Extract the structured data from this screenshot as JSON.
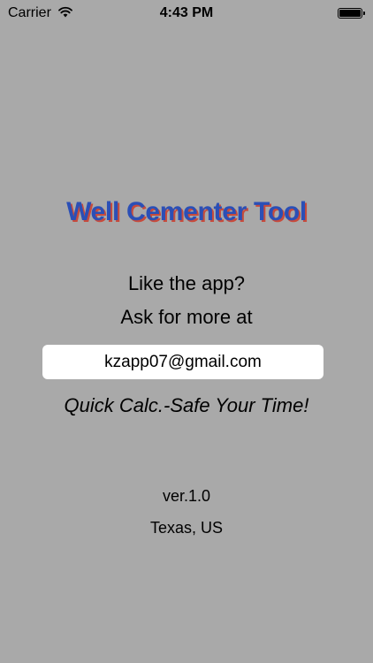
{
  "status_bar": {
    "carrier": "Carrier",
    "time": "4:43 PM",
    "wifi_icon": "wifi-icon",
    "battery_icon": "battery-icon"
  },
  "title": {
    "text": "Well Cementer Tool",
    "color": "#2b4fb6",
    "shadow_color": "#c74b3c"
  },
  "prompt": {
    "line1": "Like the app?",
    "line2": "Ask for more at"
  },
  "contact": {
    "email": "kzapp07@gmail.com"
  },
  "tagline": "Quick Calc.-Safe Your Time!",
  "footer": {
    "version": "ver.1.0",
    "location": "Texas, US"
  },
  "colors": {
    "background": "#a9a9a9",
    "field_background": "#ffffff"
  }
}
